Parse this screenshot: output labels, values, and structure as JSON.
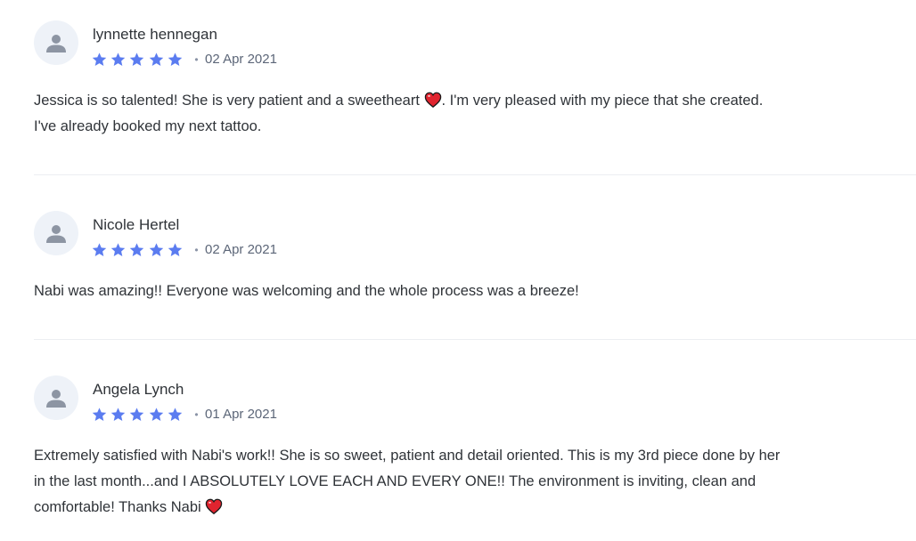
{
  "reviews": [
    {
      "author": "lynnette hennegan",
      "rating": 5,
      "date": "02 Apr 2021",
      "text_before_heart": "Jessica is so talented! She is very patient and a sweetheart ",
      "text_after_heart": ". I'm very pleased with my piece that she created.",
      "text_line2": "I've already booked my next tattoo."
    },
    {
      "author": "Nicole Hertel",
      "rating": 5,
      "date": "02 Apr 2021",
      "text": "Nabi was amazing!! Everyone was welcoming and the whole process was a breeze!"
    },
    {
      "author": "Angela Lynch",
      "rating": 5,
      "date": "01 Apr 2021",
      "text_line1": "Extremely satisfied with Nabi's work!! She is so sweet, patient and detail oriented. This is my 3rd piece done by her",
      "text_line2": "in the last month...and I ABSOLUTELY LOVE EACH AND EVERY ONE!! The environment is inviting, clean and",
      "text_line3": "comfortable! Thanks Nabi "
    }
  ],
  "separator": "•",
  "colors": {
    "star": "#5b7cf0",
    "heart": "#e0242f",
    "avatar_bg": "#eef2f8",
    "avatar_icon": "#8d95a3"
  },
  "icons": {
    "avatar": "user-silhouette-icon",
    "star": "star-icon",
    "heart": "heart-emoji-icon"
  }
}
